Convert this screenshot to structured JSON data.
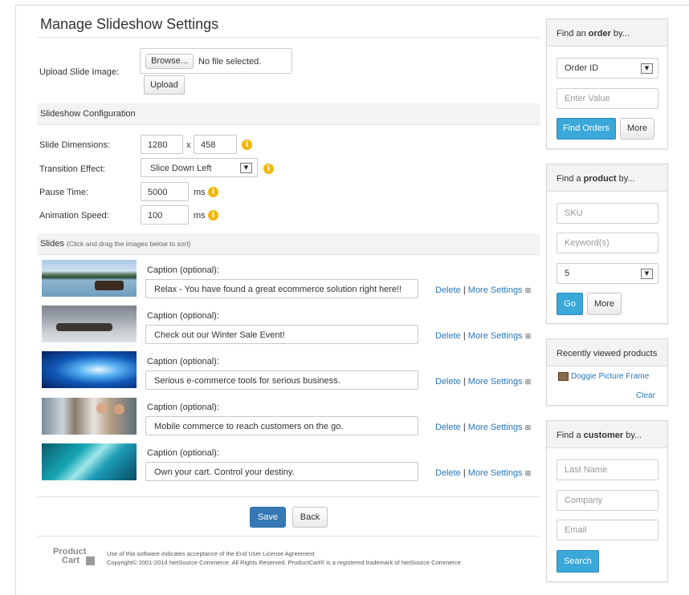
{
  "page": {
    "title": "Manage Slideshow Settings"
  },
  "upload": {
    "label": "Upload Slide Image:",
    "browse_label": "Browse...",
    "file_status": "No file selected.",
    "upload_label": "Upload"
  },
  "config": {
    "section_title": "Slideshow Configuration",
    "dimensions_label": "Slide Dimensions:",
    "width": "1280",
    "x_label": "x",
    "height": "458",
    "transition_label": "Transition Effect:",
    "transition_value": "Slice Down Left",
    "pause_label": "Pause Time:",
    "pause_value": "5000",
    "pause_unit": "ms",
    "speed_label": "Animation Speed:",
    "speed_value": "100",
    "speed_unit": "ms"
  },
  "slides": {
    "section_title": "Slides",
    "section_hint": "(Click and drag the images below to sort)",
    "items": [
      {
        "caption_label": "Caption (optional):",
        "caption": "Relax - You have found a great ecommerce solution right here!!",
        "delete_label": "Delete",
        "sep": "|",
        "more_label": "More Settings",
        "expand": "⊞"
      },
      {
        "caption_label": "Caption (optional):",
        "caption": "Check out our Winter Sale Event!",
        "delete_label": "Delete",
        "sep": "|",
        "more_label": "More Settings",
        "expand": "⊞"
      },
      {
        "caption_label": "Caption (optional):",
        "caption": "Serious e-commerce tools for serious business.",
        "delete_label": "Delete",
        "sep": "|",
        "more_label": "More Settings",
        "expand": "⊞"
      },
      {
        "caption_label": "Caption (optional):",
        "caption": "Mobile commerce to reach customers on the go.",
        "delete_label": "Delete",
        "sep": "|",
        "more_label": "More Settings",
        "expand": "⊞"
      },
      {
        "caption_label": "Caption (optional):",
        "caption": "Own your cart. Control your destiny.",
        "delete_label": "Delete",
        "sep": "|",
        "more_label": "More Settings",
        "expand": "⊞"
      }
    ]
  },
  "actions": {
    "save_label": "Save",
    "back_label": "Back"
  },
  "footer": {
    "logo_line1": "Product",
    "logo_line2": "Cart",
    "line1": "Use of this software indicates acceptance of the End User License Agreement",
    "line2": "Copyright© 2001-2014 NetSource Commerce. All Rights Reserved. ProductCart® is a registered trademark of NetSource Commerce."
  },
  "sidebar": {
    "order": {
      "head_pre": "Find an ",
      "head_bold": "order",
      "head_post": " by...",
      "select_value": "Order ID",
      "value_placeholder": "Enter Value",
      "find_label": "Find Orders",
      "more_label": "More"
    },
    "product": {
      "head_pre": "Find a ",
      "head_bold": "product",
      "head_post": " by...",
      "sku_placeholder": "SKU",
      "keyword_placeholder": "Keyword(s)",
      "select_value": "5",
      "go_label": "Go",
      "more_label": "More"
    },
    "recent": {
      "head": "Recently viewed products",
      "item": "Doggie Picture Frame",
      "clear_label": "Clear"
    },
    "customer": {
      "head_pre": "Find a ",
      "head_bold": "customer",
      "head_post": " by...",
      "last_name_placeholder": "Last Name",
      "company_placeholder": "Company",
      "email_placeholder": "Email",
      "search_label": "Search"
    }
  },
  "colors": {
    "primary_blue": "#3aa8d8",
    "save_blue": "#3677b5",
    "link_blue": "#2a77b8",
    "info_yellow": "#f2b705"
  }
}
